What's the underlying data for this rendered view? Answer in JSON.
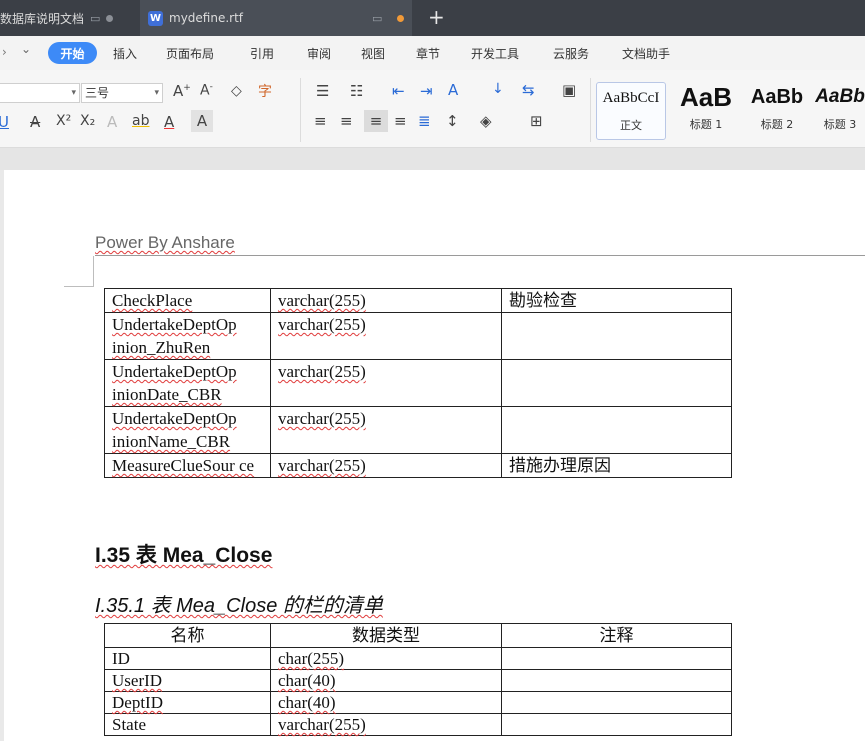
{
  "titlebar": {
    "tab1_label": "数据库说明文档",
    "tab2_icon_letter": "W",
    "tab2_label": "mydefine.rtf",
    "newtab_label": "+"
  },
  "menubar": {
    "arrow_glyph": "⌄",
    "items": [
      "开始",
      "插入",
      "页面布局",
      "引用",
      "审阅",
      "视图",
      "章节",
      "开发工具",
      "云服务",
      "文档助手"
    ]
  },
  "ribbon": {
    "font_size_value": "三号",
    "styles": [
      {
        "preview": "AaBbCcI",
        "label": "正文"
      },
      {
        "preview": "AaB",
        "label": "标题 1"
      },
      {
        "preview": "AaBb",
        "label": "标题 2"
      },
      {
        "preview": "AaBb",
        "label": "标题 3"
      }
    ]
  },
  "document": {
    "header_text": "Power By Anshare",
    "table1": [
      {
        "name": "CheckPlace",
        "type": "varchar(255)",
        "note": "勘验检查"
      },
      {
        "name": "UndertakeDeptOp inion_ZhuRen",
        "type": "varchar(255)",
        "note": ""
      },
      {
        "name": "UndertakeDeptOp inionDate_CBR",
        "type": "varchar(255)",
        "note": ""
      },
      {
        "name": "UndertakeDeptOp inionName_CBR",
        "type": "varchar(255)",
        "note": ""
      },
      {
        "name": "MeasureClueSour ce",
        "type": "varchar(255)",
        "note": "措施办理原因"
      }
    ],
    "section_title": "I.35 表 Mea_Close",
    "subsection_title": "I.35.1 表 Mea_Close 的栏的清单",
    "table2_headers": [
      "名称",
      "数据类型",
      "注释"
    ],
    "table2": [
      {
        "name": "ID",
        "type": "char(255)",
        "note": ""
      },
      {
        "name": "UserID",
        "type": "char(40)",
        "note": ""
      },
      {
        "name": "DeptID",
        "type": "char(40)",
        "note": ""
      },
      {
        "name": "State",
        "type": "varchar(255)",
        "note": ""
      }
    ]
  }
}
